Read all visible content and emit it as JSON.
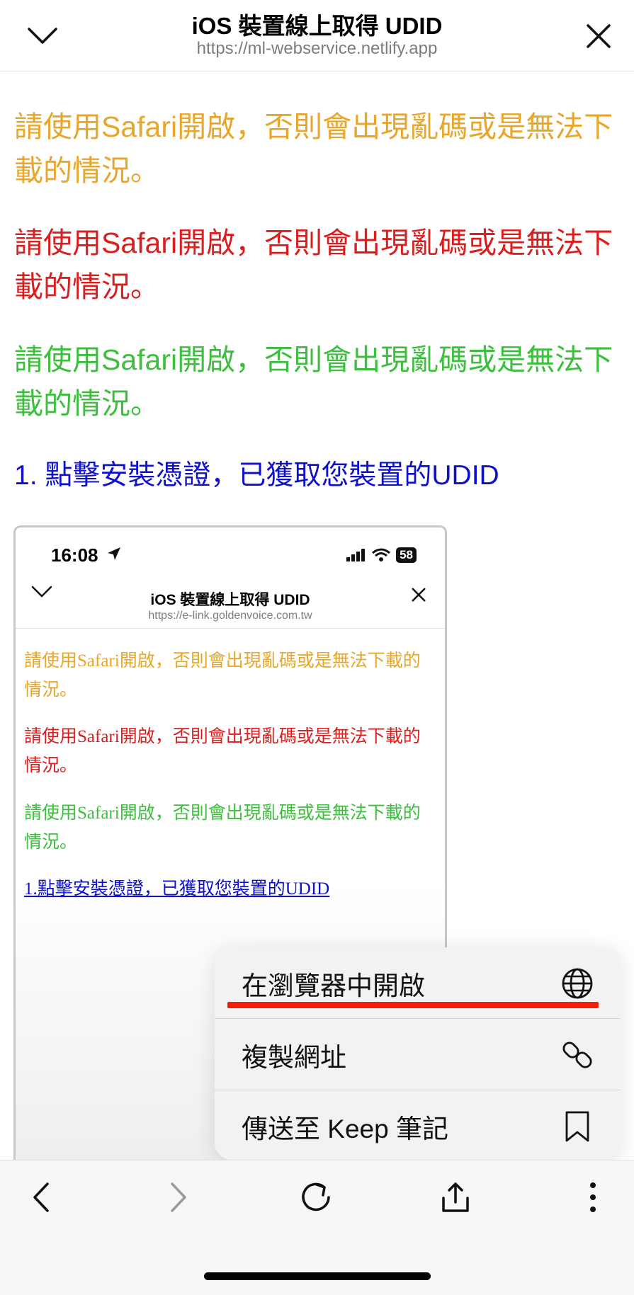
{
  "header": {
    "title": "iOS 裝置線上取得 UDID",
    "url": "https://ml-webservice.netlify.app",
    "back_icon": "chevron-down-icon",
    "close_icon": "close-icon"
  },
  "content": {
    "warnings": [
      {
        "text": "請使用Safari開啟，否則會出現亂碼或是無法下載的情況。",
        "color": "#e8a72a"
      },
      {
        "text": "請使用Safari開啟，否則會出現亂碼或是無法下載的情況。",
        "color": "#dc1d1d"
      },
      {
        "text": "請使用Safari開啟，否則會出現亂碼或是無法下載的情況。",
        "color": "#3cbf3c"
      }
    ],
    "step1": "1. 點擊安裝憑證，已獲取您裝置的UDID",
    "step_color": "#0e10cc"
  },
  "screenshot": {
    "time": "16:08",
    "battery": "58",
    "title": "iOS 裝置線上取得 UDID",
    "url": "https://e-link.goldenvoice.com.tw",
    "warnings": [
      "請使用Safari開啟，否則會出現亂碼或是無法下載的情況。",
      "請使用Safari開啟，否則會出現亂碼或是無法下載的情況。",
      "請使用Safari開啟，否則會出現亂碼或是無法下載的情況。"
    ],
    "step1": "1.點擊安裝憑證，已獲取您裝置的UDID"
  },
  "menu": {
    "items": [
      {
        "label": "在瀏覽器中開啟",
        "icon": "globe-icon",
        "highlighted": true
      },
      {
        "label": "複製網址",
        "icon": "link-icon",
        "highlighted": false
      },
      {
        "label": "傳送至 Keep 筆記",
        "icon": "bookmark-icon",
        "highlighted": false
      }
    ],
    "highlight_color": "#f61d08"
  },
  "toolbar": {
    "buttons": [
      "back-icon",
      "forward-icon",
      "reload-icon",
      "share-icon",
      "more-icon"
    ]
  }
}
